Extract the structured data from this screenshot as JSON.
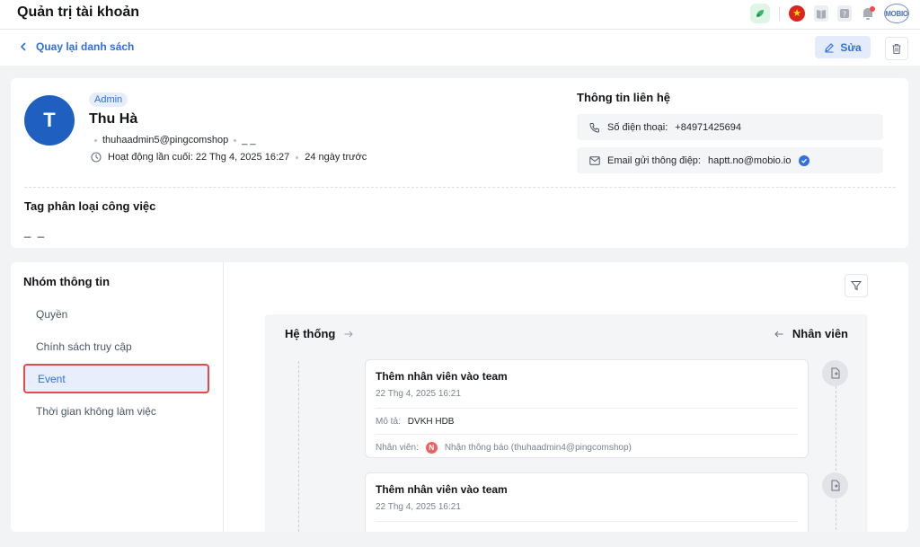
{
  "app": {
    "title": "Quản trị tài khoản"
  },
  "topbar": {
    "icons": [
      "leaf-app-icon",
      "vietnam-flag-icon",
      "book-icon",
      "help-icon",
      "bell-icon",
      "mobio-logo"
    ],
    "logo_text": "MOBIO",
    "notification_dot_color": "#f24a4a"
  },
  "subbar": {
    "back_label": "Quay lại danh sách",
    "edit_label": "Sửa"
  },
  "profile": {
    "avatar_letter": "T",
    "role": "Admin",
    "name": "Thu Hà",
    "email": "thuhaadmin5@pingcomshop",
    "extra": "_ _",
    "last_active": "Hoạt động lần cuối: 22 Thg 4, 2025 16:27",
    "ago": "24 ngày trước",
    "avatar_color": "#1f5fbf"
  },
  "contact": {
    "title": "Thông tin liên hệ",
    "phone_label": "Số điện thoại:",
    "phone_value": "+84971425694",
    "email_label": "Email gửi thông điệp:",
    "email_value": "haptt.no@mobio.io"
  },
  "tags": {
    "title": "Tag phân loại công việc",
    "value": "_ _"
  },
  "sidebar": {
    "title": "Nhóm thông tin",
    "items": [
      {
        "label": "Quyền",
        "active": false
      },
      {
        "label": "Chính sách truy cập",
        "active": false
      },
      {
        "label": "Event",
        "active": true
      },
      {
        "label": "Thời gian không làm việc",
        "active": false
      }
    ]
  },
  "timeline": {
    "left_label": "Hệ thống",
    "right_label": "Nhân viên",
    "events": [
      {
        "title": "Thêm nhân viên vào team",
        "time": "22 Thg 4, 2025 16:21",
        "desc_label": "Mô tả:",
        "desc_value": "DVKH HDB",
        "staff_label": "Nhân viên:",
        "staff_value": "Nhận thông báo (thuhaadmin4@pingcomshop)",
        "staff_badge": "N"
      },
      {
        "title": "Thêm nhân viên vào team",
        "time": "22 Thg 4, 2025 16:21"
      }
    ]
  },
  "colors": {
    "accent": "#2f6fe0",
    "highlight_border": "#e5484d"
  }
}
